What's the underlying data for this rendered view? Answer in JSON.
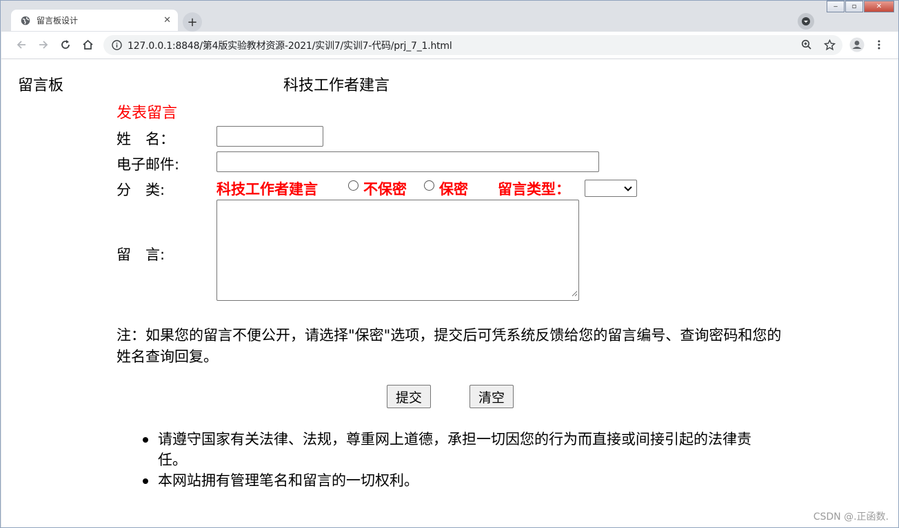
{
  "browser": {
    "tab_title": "留言板设计",
    "tab_close": "✕",
    "new_tab": "+",
    "url": "127.0.0.1:8848/第4版实验教材资源-2021/实训7/实训7-代码/prj_7_1.html"
  },
  "page": {
    "title": "留言板",
    "subtitle": "科技工作者建言",
    "form_heading": "发表留言"
  },
  "form": {
    "name_label": "姓　名：",
    "name_value": "",
    "email_label": "电子邮件:",
    "email_value": "",
    "category_label": "分　类:",
    "category_value": "科技工作者建言",
    "radio_options": [
      "不保密",
      "保密"
    ],
    "type_label": "留言类型：",
    "type_selected": "",
    "message_label": "留　言:",
    "message_value": ""
  },
  "note": "注：如果您的留言不便公开，请选择\"保密\"选项，提交后可凭系统反馈给您的留言编号、查询密码和您的姓名查询回复。",
  "buttons": {
    "submit": "提交",
    "clear": "清空"
  },
  "rules": [
    "请遵守国家有关法律、法规，尊重网上道德，承担一切因您的行为而直接或间接引起的法律责任。",
    "本网站拥有管理笔名和留言的一切权利。"
  ],
  "watermark": "CSDN @.正函数.",
  "colors": {
    "accent_red": "#ff0000"
  }
}
